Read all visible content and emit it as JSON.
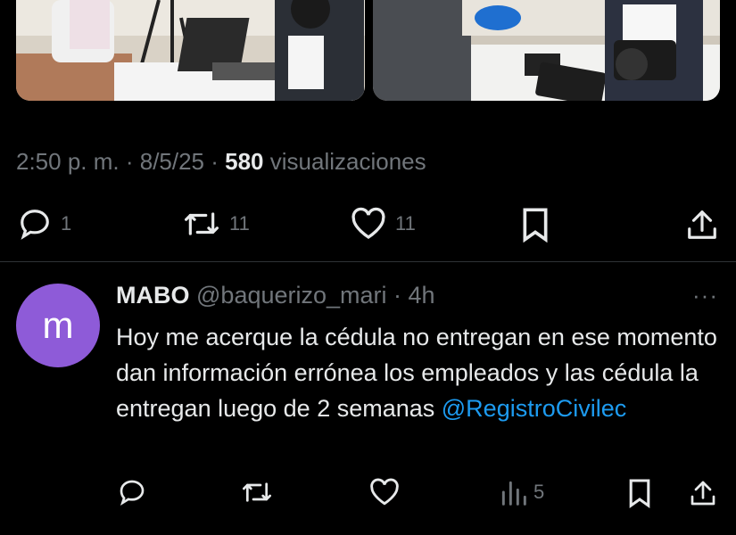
{
  "media": [
    {
      "name": "photo-left",
      "alt": ""
    },
    {
      "name": "photo-right",
      "alt": ""
    }
  ],
  "post": {
    "time": "2:50 p. m.",
    "sep1": " · ",
    "date": "8/5/25",
    "sep2": " · ",
    "views": "580",
    "views_label": " visualizaciones",
    "replies": "1",
    "reposts": "11",
    "likes": "11"
  },
  "reply": {
    "avatar_letter": "m",
    "name": "MABO",
    "handle": "@baquerizo_mari",
    "dot": " · ",
    "time": "4h",
    "more": "···",
    "text": "Hoy me acerque la cédula no entregan en ese momento dan información errónea los empleados y las cédula la entregan luego de 2 semanas ",
    "mention": "@RegistroCivilec",
    "views": "5"
  },
  "colors": {
    "background": "#000000",
    "text": "#e7e9ea",
    "muted": "#71767b",
    "link": "#1d9bf0",
    "avatar": "#8e5bd8"
  },
  "icons": [
    "reply-icon",
    "repost-icon",
    "like-icon",
    "bookmark-icon",
    "share-icon",
    "views-icon",
    "more-icon"
  ]
}
